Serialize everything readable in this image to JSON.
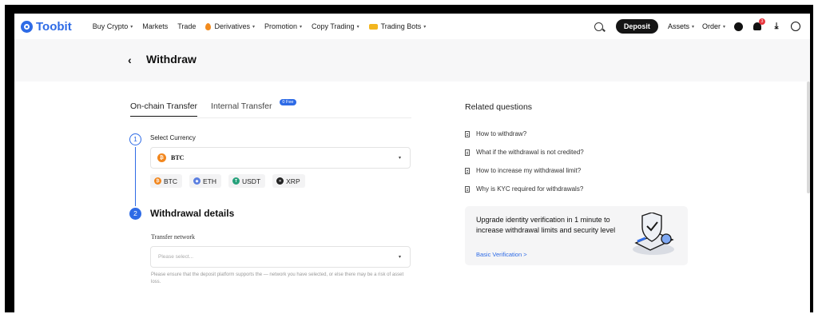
{
  "nav": {
    "logo_text": "Toobit",
    "menu": [
      {
        "label": "Buy Crypto",
        "caret": "▾"
      },
      {
        "label": "Markets",
        "caret": ""
      },
      {
        "label": "Trade",
        "caret": ""
      },
      {
        "label": "Derivatives",
        "caret": "▾"
      },
      {
        "label": "Promotion",
        "caret": "▾"
      },
      {
        "label": "Copy Trading",
        "caret": "▾"
      },
      {
        "label": "Trading Bots",
        "caret": "▾"
      }
    ],
    "deposit_label": "Deposit",
    "assets_label": "Assets",
    "order_label": "Order",
    "notification_count": "3",
    "caret": "▾",
    "download_glyph": "⤓"
  },
  "header": {
    "back_glyph": "‹",
    "title": "Withdraw"
  },
  "tabs": {
    "onchain": "On-chain Transfer",
    "internal": "Internal Transfer",
    "fee_badge": "0 Fee"
  },
  "step1": {
    "number": "1",
    "label": "Select Currency",
    "selected_coin": "BTC",
    "selected_coin_glyph": "₿",
    "caret": "▾",
    "quick_coins": [
      {
        "symbol": "BTC",
        "glyph": "₿"
      },
      {
        "symbol": "ETH",
        "glyph": "◆"
      },
      {
        "symbol": "USDT",
        "glyph": "T"
      },
      {
        "symbol": "XRP",
        "glyph": "✕"
      }
    ]
  },
  "step2": {
    "number": "2",
    "title": "Withdrawal details",
    "network_label": "Transfer network",
    "network_placeholder": "Please select...",
    "caret": "▾",
    "notice": "Please ensure that the deposit platform supports the — network you have selected, or else there may be a risk of asset loss."
  },
  "related": {
    "title": "Related questions",
    "items": [
      "How to withdraw?",
      "What if the withdrawal is not credited?",
      "How to increase my withdrawal limit?",
      "Why is KYC required for withdrawals?"
    ]
  },
  "promo": {
    "text": "Upgrade identity verification in 1 minute to increase withdrawal limits and security level",
    "link": "Basic Verification >"
  },
  "colors": {
    "brand": "#2e6be6",
    "dark": "#151515",
    "alert": "#e8363e"
  }
}
